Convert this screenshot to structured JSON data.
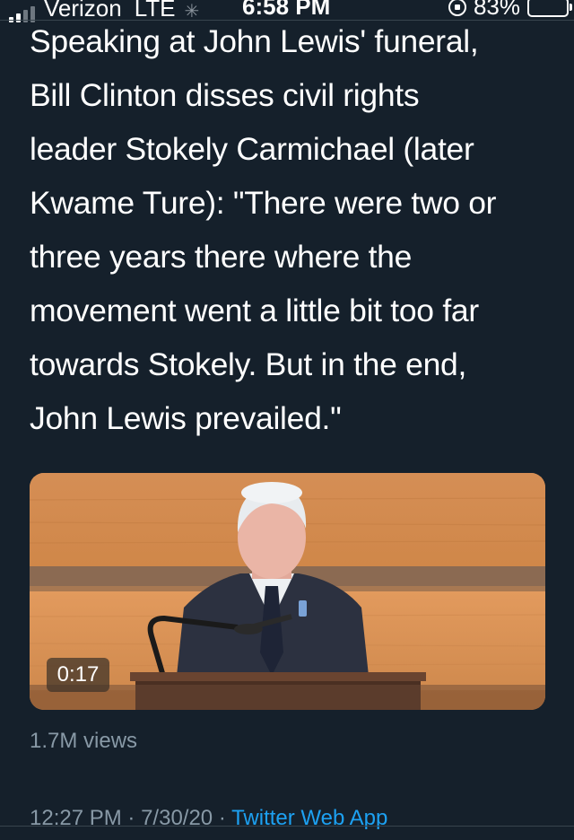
{
  "status_bar": {
    "carrier": "Verizon",
    "network": "LTE",
    "time": "6:58 PM",
    "battery": "83%",
    "battery_level": 0.83
  },
  "tweet": {
    "text": "Speaking at John Lewis' funeral,\nBill Clinton disses civil rights\nleader Stokely Carmichael (later\nKwame Ture): \"There were two or\nthree years there where the\nmovement went a little bit too far\ntowards Stokely. But in the end,\nJohn Lewis prevailed.\"",
    "video": {
      "duration": "0:17"
    },
    "views": "1.7M views",
    "time": "12:27 PM",
    "separator": "·",
    "date": "7/30/20",
    "source": "Twitter Web App"
  },
  "colors": {
    "background": "#15202b",
    "text": "#ffffff",
    "muted": "#8899a6",
    "link": "#1da1f2"
  }
}
